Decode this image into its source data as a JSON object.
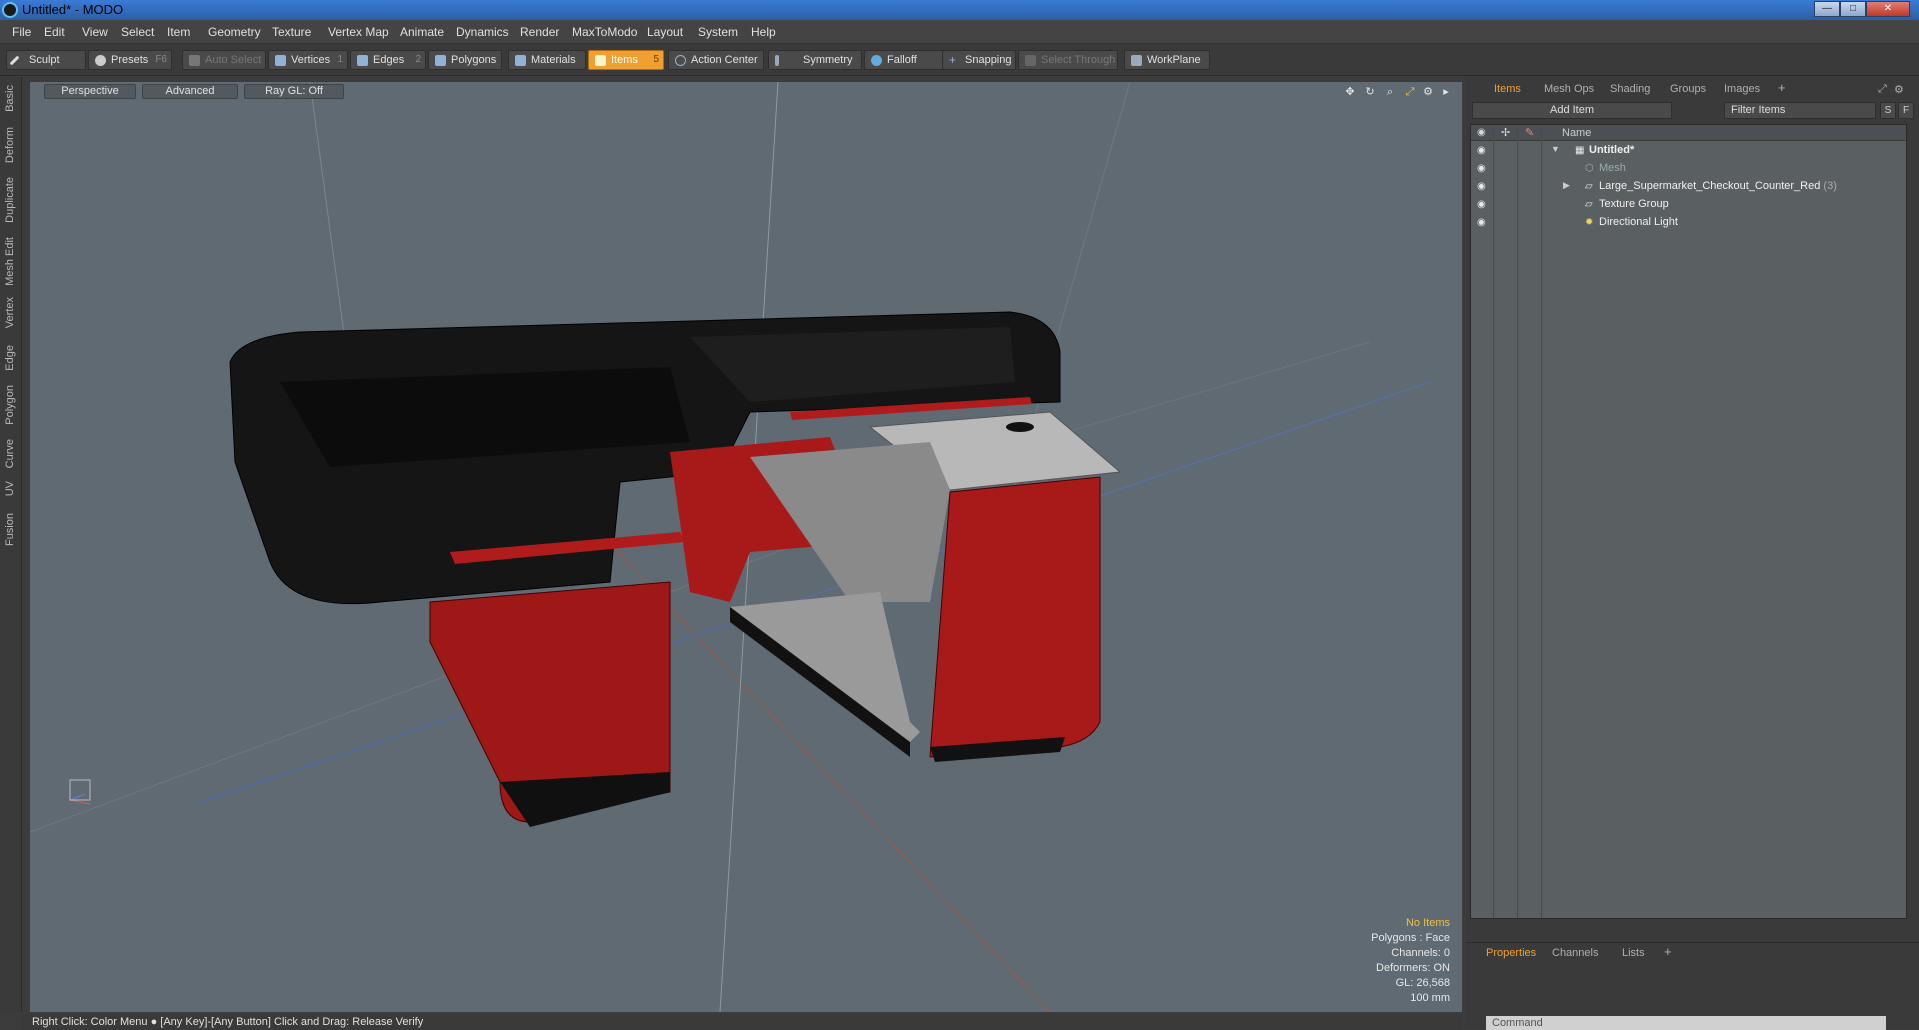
{
  "window": {
    "title": "Untitled* - MODO",
    "minimize": "—",
    "maximize": "□",
    "close": "✕"
  },
  "menu": [
    "File",
    "Edit",
    "View",
    "Select",
    "Item",
    "Geometry",
    "Texture",
    "Vertex Map",
    "Animate",
    "Dynamics",
    "Render",
    "MaxToModo",
    "Layout",
    "System",
    "Help"
  ],
  "toolbar": {
    "sculpt": "Sculpt",
    "presets": "Presets",
    "presets_key": "F6",
    "auto_select": "Auto Select",
    "vertices": "Vertices",
    "vertices_key": "1",
    "edges": "Edges",
    "edges_key": "2",
    "polygons": "Polygons",
    "materials": "Materials",
    "items": "Items",
    "items_key": "5",
    "action_center": "Action Center",
    "symmetry": "Symmetry",
    "falloff": "Falloff",
    "snapping": "Snapping",
    "select_through": "Select Through",
    "workplane": "WorkPlane"
  },
  "left_tabs": [
    "Basic",
    "Deform",
    "Duplicate",
    "Mesh Edit",
    "Vertex",
    "Edge",
    "Polygon",
    "Curve",
    "UV",
    "Fusion"
  ],
  "viewport": {
    "view_mode": "Perspective",
    "shading": "Advanced",
    "raygl": "Ray GL: Off",
    "stats": {
      "selection": "No Items",
      "polygons": "Polygons : Face",
      "channels": "Channels: 0",
      "deformers": "Deformers: ON",
      "gl": "GL: 26,568",
      "unit": "100 mm"
    }
  },
  "right_panel": {
    "tabs": [
      "Items",
      "Mesh Ops",
      "Shading",
      "Groups",
      "Images"
    ],
    "add_item": "Add Item",
    "filter_placeholder": "Filter Items",
    "s_btn": "S",
    "f_btn": "F",
    "column_name": "Name",
    "tree": [
      {
        "label": "Untitled*",
        "expanded": "▼"
      },
      {
        "label": "Mesh"
      },
      {
        "label": "Large_Supermarket_Checkout_Counter_Red",
        "count": "(3)",
        "expanded": "▶"
      },
      {
        "label": "Texture Group"
      },
      {
        "label": "Directional Light"
      }
    ],
    "bottom_tabs": [
      "Properties",
      "Channels",
      "Lists"
    ],
    "command_placeholder": "Command"
  },
  "status_bar": "Right Click: Color Menu ● [Any Key]-[Any Button] Click and Drag: Release Verify",
  "colors": {
    "accent": "#f0a030",
    "counter_red": "#b01c1c",
    "counter_black": "#141414",
    "shelf_gray": "#9a9a9a"
  }
}
